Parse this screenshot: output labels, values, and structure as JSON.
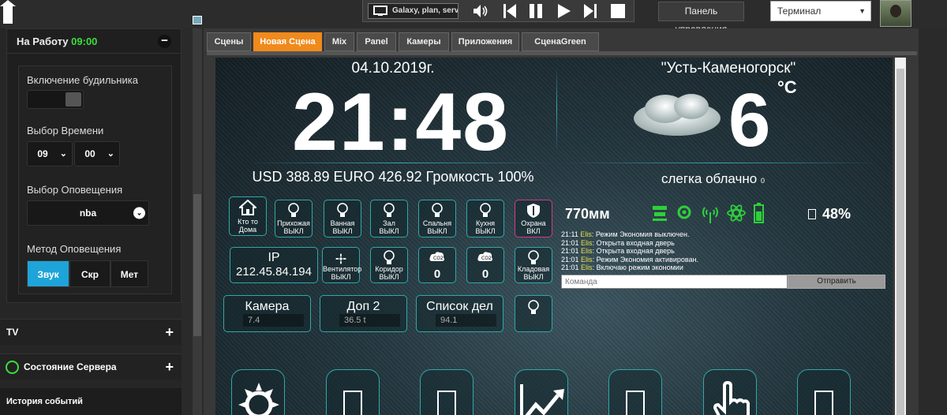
{
  "topbar": {
    "device_name": "Galaxy, plan, serv",
    "panel_button": "Панель управления",
    "terminal_select": "Терминал"
  },
  "sidebar": {
    "card_title": "На Работу",
    "card_time": "09:00",
    "alarm_label": "Включение будильника",
    "time_label": "Выбор Времени",
    "hour": "09",
    "minute": "00",
    "notify_label": "Выбор Оповещения",
    "notify_value": "nba",
    "method_label": "Метод Оповещения",
    "methods": [
      "Звук",
      "Скр",
      "Мет"
    ],
    "sections": {
      "tv": "TV",
      "server": "Состояние Сервера",
      "history": "История событий"
    }
  },
  "tabs": [
    "Сцены",
    "Новая Сцена",
    "Mix",
    "Panel",
    "Камеры",
    "Приложения",
    "СценаGreen"
  ],
  "active_tab": "Новая Сцена",
  "dashboard": {
    "date": "04.10.2019г.",
    "clock": "21:48",
    "rates": "USD 388.89   EURO 426.92   Громкость 100%",
    "city": "\"Усть-Каменогорск\"",
    "temp": "6",
    "temp_unit": "°C",
    "condition": "слегка облачно",
    "condition_extra": "0",
    "tiles_row1": [
      {
        "label": "Кто то\nДома",
        "icon": "home-icon"
      },
      {
        "label": "Прихожая\nВЫКЛ",
        "icon": "bulb-icon"
      },
      {
        "label": "Ванная\nВЫКЛ",
        "icon": "bulb-icon"
      },
      {
        "label": "Зал\nВЫКЛ",
        "icon": "bulb-icon"
      },
      {
        "label": "Спальня\nВЫКЛ",
        "icon": "bulb-icon"
      },
      {
        "label": "Кухня\nВЫКЛ",
        "icon": "bulb-icon"
      },
      {
        "label": "Охрана\nВКЛ",
        "icon": "shield-icon"
      }
    ],
    "ip_label": "IP",
    "ip_value": "212.45.84.194",
    "fan_label": "Вентилятор\nВЫКЛ",
    "corridor_label": "Коридор\nВЫКЛ",
    "co2_a": "0",
    "co2_b": "0",
    "storage_label": "Кладовая\nВЫКЛ",
    "camera_title": "Камера",
    "camera_value": "7.4",
    "dop_title": "Доп 2",
    "dop_value": "36.5 t",
    "list_title": "Список дел",
    "list_value": "94.1",
    "rain": "770мм",
    "battery_pct": "48%",
    "log": [
      {
        "time": "21:11",
        "who": "Elis",
        "text": ": Режим Экономия выключен."
      },
      {
        "time": "21:01",
        "who": "Elis",
        "text": ": Открыта входная дверь"
      },
      {
        "time": "21:01",
        "who": "Elis",
        "text": ": Открыта входная дверь"
      },
      {
        "time": "21:01",
        "who": "Elis",
        "text": ": Режим Экономия активирован."
      },
      {
        "time": "21:01",
        "who": "Elis",
        "text": ": Включаю режим экономии"
      }
    ],
    "command_placeholder": "Команда",
    "send_label": "Отправить"
  },
  "colors": {
    "accent_green": "#3ddc3d",
    "tab_active": "#f08a1c",
    "method_active": "#1ea4d8",
    "tile_border": "#2fa8a8",
    "alarm_border": "#d23a8a"
  }
}
